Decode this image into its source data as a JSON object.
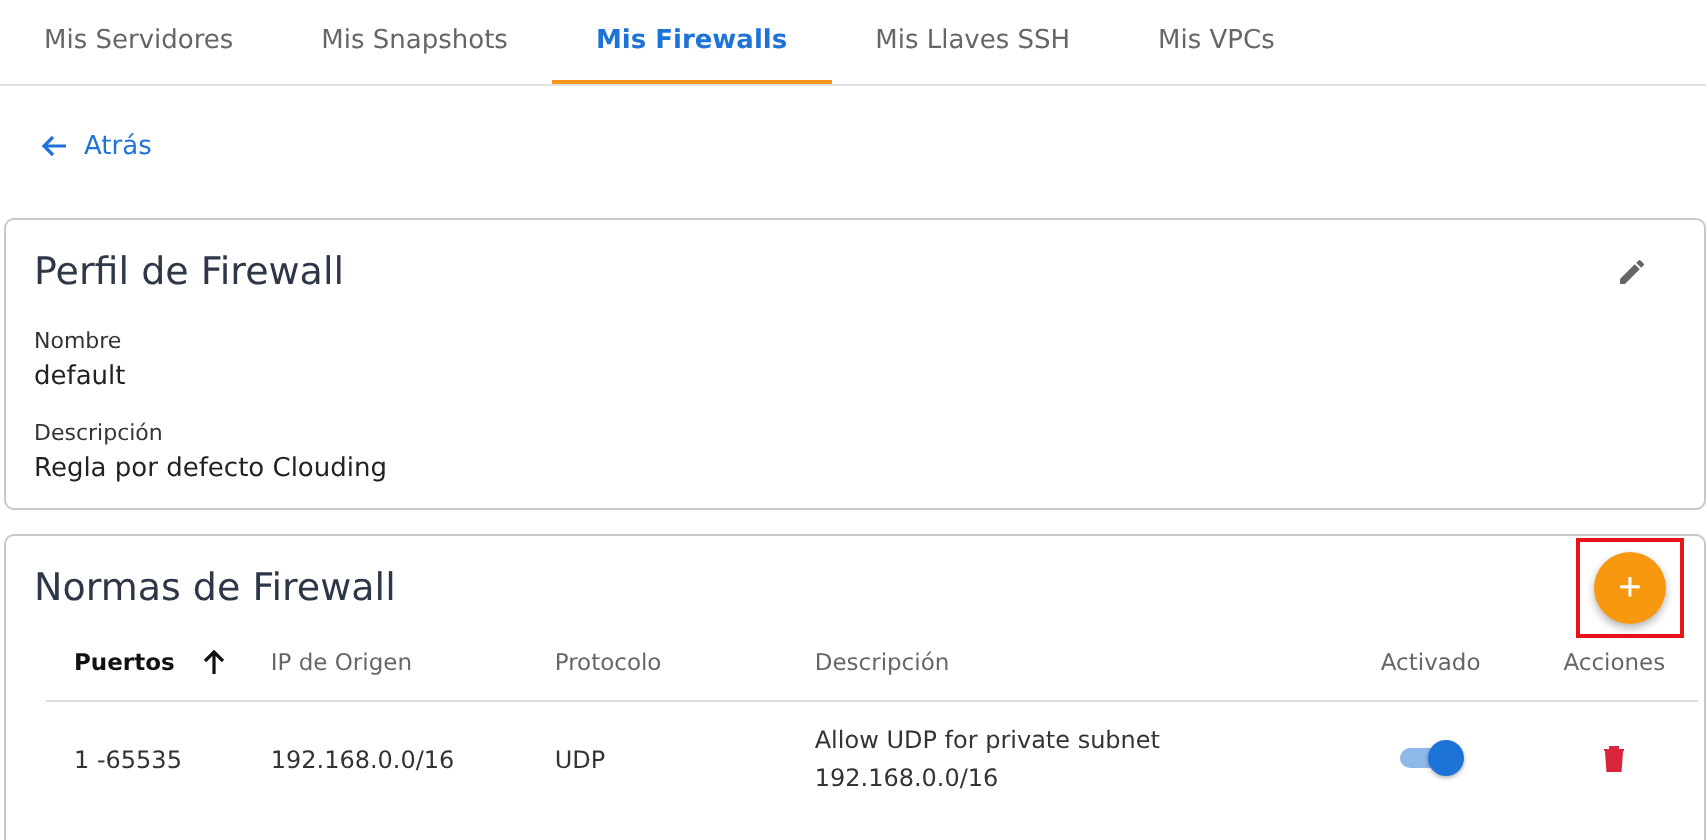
{
  "tabs": [
    {
      "label": "Mis Servidores",
      "selected": false
    },
    {
      "label": "Mis Snapshots",
      "selected": false
    },
    {
      "label": "Mis Firewalls",
      "selected": true
    },
    {
      "label": "Mis Llaves SSH",
      "selected": false
    },
    {
      "label": "Mis VPCs",
      "selected": false
    }
  ],
  "back_link": "Atrás",
  "profile": {
    "title": "Perfil de Firewall",
    "fields": [
      {
        "label": "Nombre",
        "value": "default"
      },
      {
        "label": "Descripción",
        "value": "Regla por defecto Clouding"
      }
    ]
  },
  "rules": {
    "title": "Normas de Firewall",
    "add_button": "+",
    "add_highlighted": true,
    "table": {
      "columns": [
        {
          "label": "Puertos",
          "sorted": true
        },
        {
          "label": "IP de Origen",
          "sorted": false
        },
        {
          "label": "Protocolo",
          "sorted": false
        },
        {
          "label": "Descripción",
          "sorted": false
        },
        {
          "label": "Activado",
          "sorted": false
        },
        {
          "label": "Acciones",
          "sorted": false
        }
      ],
      "rows": [
        {
          "ports": "1 -65535",
          "source_ip": "192.168.0.0/16",
          "protocol": "UDP",
          "description": [
            "Allow UDP for private subnet",
            "192.168.0.0/16"
          ],
          "enabled": true
        }
      ]
    }
  }
}
